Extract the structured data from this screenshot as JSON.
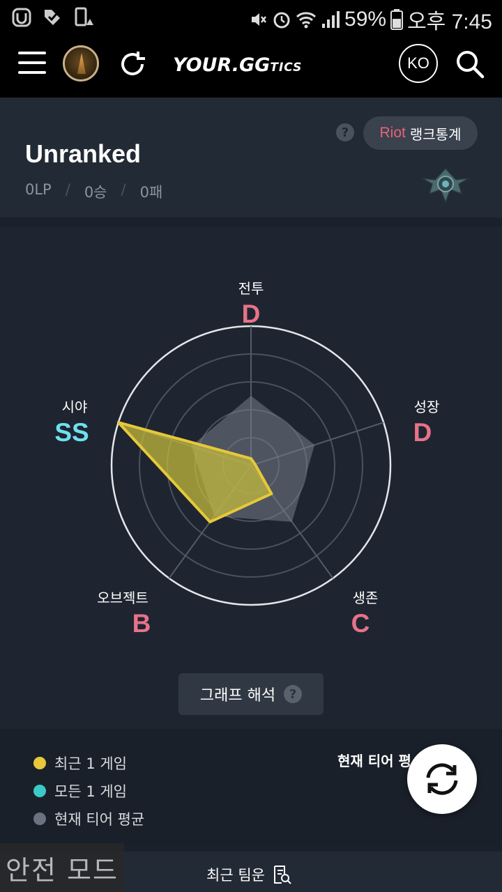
{
  "status_bar": {
    "battery": "59%",
    "time": "오후 7:45"
  },
  "app_bar": {
    "logo_main": "YOUR.GG",
    "logo_suffix": "TICS",
    "language": "KO"
  },
  "rank": {
    "riot_label": "Riot",
    "rank_stats_label": "랭크통계",
    "tier": "Unranked",
    "lp": "0LP",
    "wins": "0승",
    "losses": "0패",
    "separator": "/"
  },
  "radar": {
    "axes": [
      {
        "name": "전투",
        "grade": "D"
      },
      {
        "name": "성장",
        "grade": "D"
      },
      {
        "name": "생존",
        "grade": "C"
      },
      {
        "name": "오브젝트",
        "grade": "B"
      },
      {
        "name": "시야",
        "grade": "SS"
      }
    ],
    "recent_game_values": [
      0.05,
      0.03,
      0.25,
      0.5,
      1.0
    ],
    "tier_average_values": [
      0.5,
      0.48,
      0.5,
      0.45,
      0.45
    ],
    "series_colors": {
      "recent": "#e6c83a",
      "all": "#3cc8c8",
      "tier_avg": "#6b7280"
    },
    "graph_button": "그래프 해석"
  },
  "legend": {
    "items": [
      {
        "label": "최근 1 게임",
        "color": "#e6c83a"
      },
      {
        "label": "모든 1 게임",
        "color": "#3cc8c8"
      },
      {
        "label": "현재 티어 평균",
        "color": "#6b7280"
      }
    ],
    "current_tier_avg": "현재 티어 평"
  },
  "bottom": {
    "label": "최근 팀운",
    "safe_mode": "안전 모드"
  }
}
